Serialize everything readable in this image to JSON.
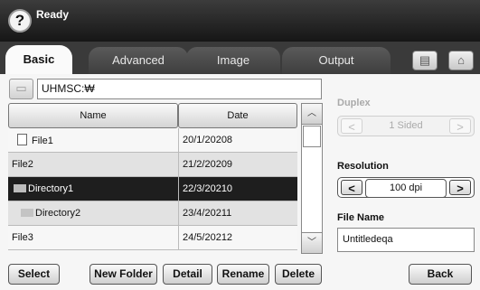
{
  "status": {
    "text": "Ready"
  },
  "tabs": [
    {
      "label": "Basic"
    },
    {
      "label": "Advanced"
    },
    {
      "label": "Image"
    },
    {
      "label": "Output"
    }
  ],
  "header_icons": [
    "job-status-icon",
    "home-icon"
  ],
  "path": {
    "value": "UHMSC:₩"
  },
  "table": {
    "columns": [
      "Name",
      "Date"
    ],
    "rows": [
      {
        "name": "File1",
        "date": "20/1/20208"
      },
      {
        "name": "File2",
        "date": "21/2/20209"
      },
      {
        "name": "Directory1",
        "date": "22/3/20210"
      },
      {
        "name": "Directory2",
        "date": "23/4/20211"
      },
      {
        "name": "File3",
        "date": "24/5/20212"
      }
    ]
  },
  "duplex": {
    "label": "Duplex",
    "value": "1 Sided"
  },
  "resolution": {
    "label": "Resolution",
    "value": "100 dpi"
  },
  "file_name": {
    "label": "File Name",
    "value": "Untitledeqa"
  },
  "buttons": {
    "select": "Select",
    "new_folder": "New Folder",
    "detail": "Detail",
    "rename": "Rename",
    "delete": "Delete",
    "back": "Back"
  },
  "colors": {
    "header": "#2a2a2a",
    "selected_row": "#1e1e1e",
    "panel": "#f6f6f6"
  }
}
